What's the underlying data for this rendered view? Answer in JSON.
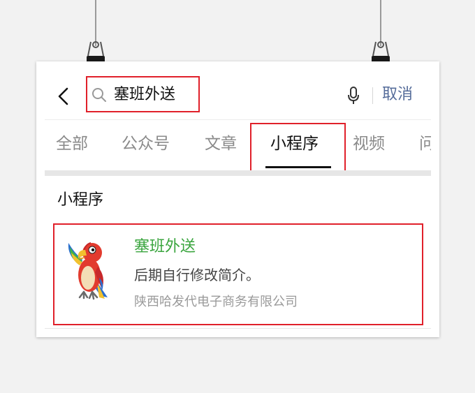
{
  "search": {
    "query": "塞班外送",
    "cancel_label": "取消"
  },
  "tabs": [
    {
      "label": "全部"
    },
    {
      "label": "公众号"
    },
    {
      "label": "文章"
    },
    {
      "label": "小程序"
    },
    {
      "label": "视频"
    },
    {
      "label": "问"
    }
  ],
  "active_tab": "小程序",
  "section": {
    "title": "小程序"
  },
  "result": {
    "name": "塞班外送",
    "description": "后期自行修改简介。",
    "company": "陕西哈发代电子商务有限公司",
    "icon": "parrot-mascot"
  },
  "colors": {
    "highlight_box": "#e0202a",
    "result_name": "#3aa53e",
    "cancel": "#556c9a"
  }
}
